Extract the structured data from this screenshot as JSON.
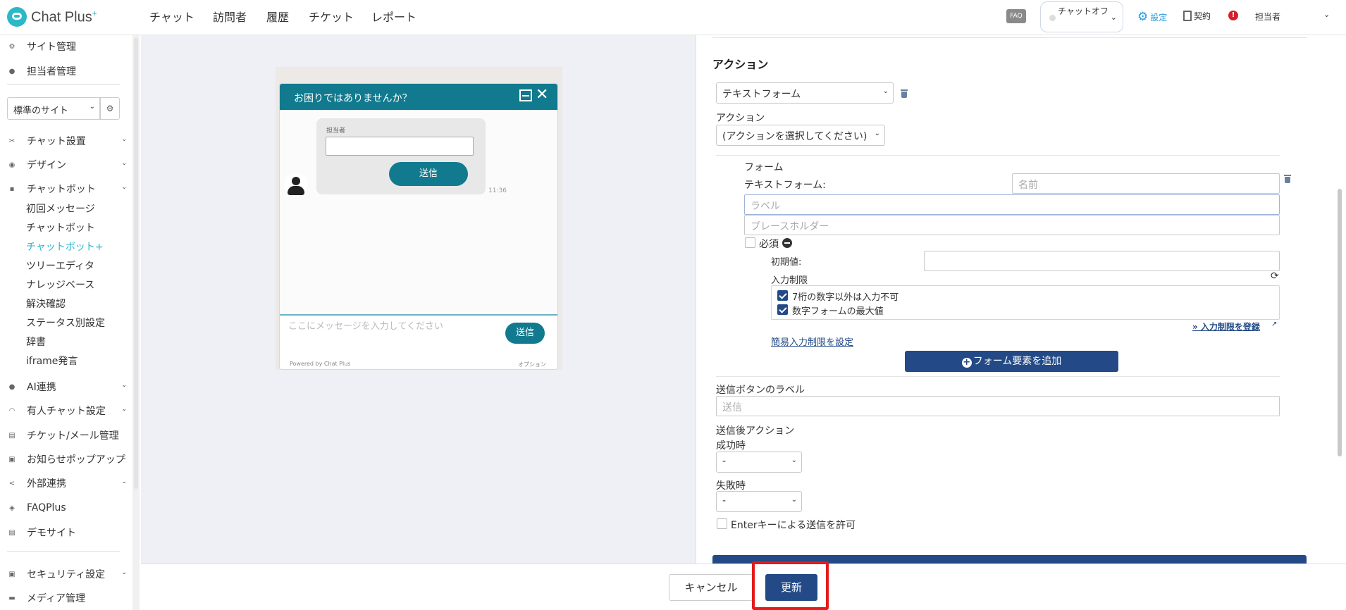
{
  "app": {
    "logo_text": "Chat Plus",
    "logo_sup": "+"
  },
  "topnav": [
    "チャット",
    "訪問者",
    "履歴",
    "チケット",
    "レポート"
  ],
  "topbar": {
    "faq": "FAQ",
    "status": "チャットオフ",
    "settings": "設定",
    "contract": "契約",
    "user": "担当者"
  },
  "sidebar": {
    "site_admin": "サイト管理",
    "staff_admin": "担当者管理",
    "site_select": "標準のサイト",
    "chat_settings": "チャット設置",
    "design": "デザイン",
    "chatbot": "チャットボット",
    "sub": [
      "初回メッセージ",
      "チャットボット",
      "チャットボット+",
      "ツリーエディタ",
      "ナレッジベース",
      "解決確認",
      "ステータス別設定",
      "辞書",
      "iframe発言"
    ],
    "ai": "AI連携",
    "paid_chat": "有人チャット設定",
    "ticket_mail": "チケット/メール管理",
    "popup": "お知らせポップアップ",
    "external": "外部連携",
    "faqplus": "FAQPlus",
    "demo": "デモサイト",
    "security": "セキュリティ設定",
    "media": "メディア管理"
  },
  "preview": {
    "title": "お困りではありませんか？",
    "field_label": "担当者",
    "send": "送信",
    "time": "11:36",
    "placeholder": "ここにメッセージを入力してください",
    "powered": "Powered by Chat Plus",
    "option": "オプション"
  },
  "panel": {
    "section_title": "アクション",
    "type_select": "テキストフォーム",
    "action_label": "アクション",
    "action_select": "(アクションを選択してください)",
    "form_label": "フォーム",
    "textform_label": "テキストフォーム:",
    "name_placeholder": "名前",
    "label_placeholder": "ラベル",
    "ph_placeholder": "プレースホルダー",
    "required": "必須",
    "initial": "初期値:",
    "limit_label": "入力制限",
    "limits": [
      "7桁の数字以外は入力不可",
      "数字フォームの最大値"
    ],
    "register_link": "» 入力制限を登録",
    "simple_link": "簡易入力制限を設定",
    "add_button": "フォーム要素を追加",
    "submit_label": "送信ボタンのラベル",
    "submit_placeholder": "送信",
    "after_action": "送信後アクション",
    "success": "成功時",
    "fail": "失敗時",
    "dash": "-",
    "enter": "Enterキーによる送信を許可"
  },
  "footer": {
    "cancel": "キャンセル",
    "update": "更新"
  }
}
